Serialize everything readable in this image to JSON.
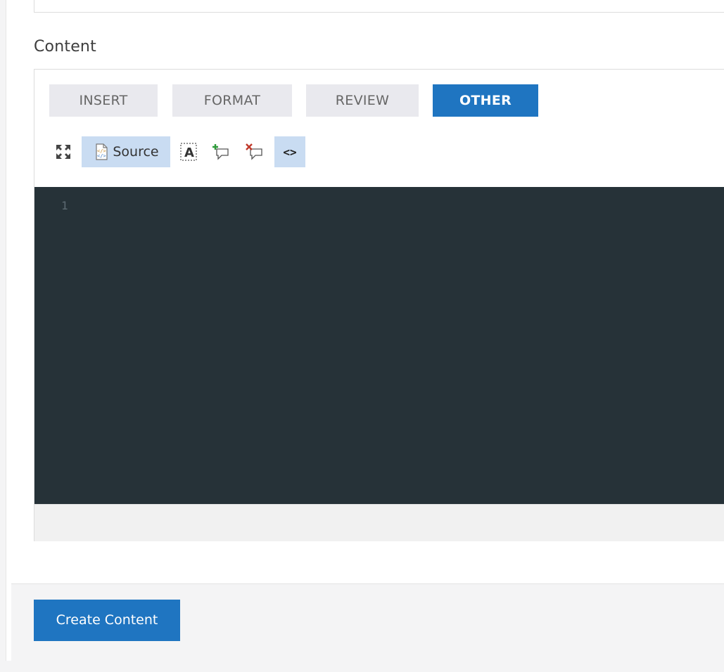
{
  "content_field": {
    "label": "Content"
  },
  "editor": {
    "tabs": [
      {
        "label": "INSERT",
        "active": false
      },
      {
        "label": "FORMAT",
        "active": false
      },
      {
        "label": "REVIEW",
        "active": false
      },
      {
        "label": "OTHER",
        "active": true
      }
    ],
    "toolbar": {
      "maximize_icon": "maximize-icon",
      "source_icon": "source-icon",
      "source_label": "Source",
      "find_icon": "text-select-icon",
      "add_comment_icon": "add-comment-icon",
      "remove_comment_icon": "remove-comment-icon",
      "code_icon": "code-icon",
      "code_glyph": "<>"
    },
    "code": {
      "line_numbers": [
        "1"
      ]
    }
  },
  "actions": {
    "create_label": "Create Content"
  },
  "colors": {
    "primary": "#1f75c1",
    "editor_bg": "#263238",
    "tab_bg": "#e9e9ee",
    "active_tool_bg": "#c9dcf2"
  }
}
